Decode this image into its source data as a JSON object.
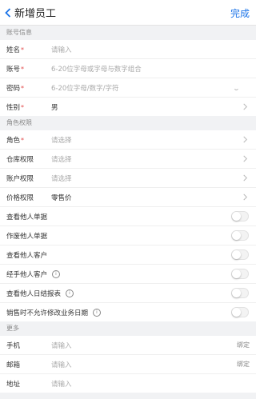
{
  "nav": {
    "back_icon": "chevron-left-icon",
    "title": "新增员工",
    "done": "完成"
  },
  "sections": {
    "account": "账号信息",
    "role": "角色权限",
    "more": "更多"
  },
  "account": {
    "name": {
      "label": "姓名",
      "required": "*",
      "placeholder": "请输入"
    },
    "account": {
      "label": "账号",
      "required": "*",
      "placeholder": "6-20位字母或字母与数字组合"
    },
    "password": {
      "label": "密码",
      "required": "*",
      "placeholder": "6-20位字母/数字/字符",
      "eye": "⌣"
    },
    "gender": {
      "label": "性别",
      "required": "*",
      "value": "男"
    }
  },
  "role": {
    "role": {
      "label": "角色",
      "required": "*",
      "placeholder": "请选择"
    },
    "warehouse": {
      "label": "仓库权限",
      "placeholder": "请选择"
    },
    "account_perm": {
      "label": "账户权限",
      "placeholder": "请选择"
    },
    "price": {
      "label": "价格权限",
      "value": "零售价"
    }
  },
  "toggles": [
    {
      "label": "查看他人单据",
      "on": false,
      "info": ""
    },
    {
      "label": "作废他人单据",
      "on": false,
      "info": ""
    },
    {
      "label": "查看他人客户",
      "on": false,
      "info": ""
    },
    {
      "label": "经手他人客户",
      "on": false,
      "info": "i"
    },
    {
      "label": "查看他人日结报表",
      "on": false,
      "info": "i"
    },
    {
      "label": "销售时不允许修改业务日期",
      "on": false,
      "info": "i"
    }
  ],
  "more": {
    "phone": {
      "label": "手机",
      "placeholder": "请输入",
      "action": "绑定"
    },
    "email": {
      "label": "邮箱",
      "placeholder": "请输入",
      "action": "绑定"
    },
    "address": {
      "label": "地址",
      "placeholder": "请输入"
    }
  }
}
